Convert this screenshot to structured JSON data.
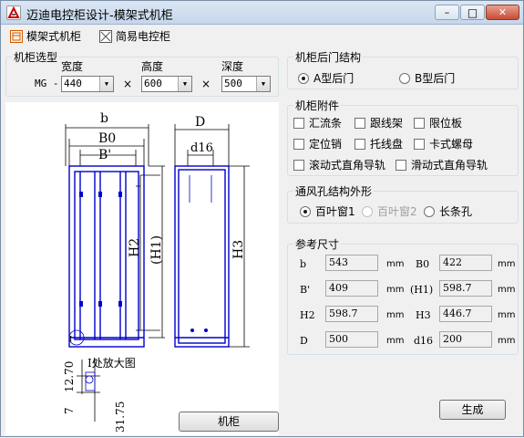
{
  "window": {
    "title": "迈迪电控柜设计-模架式机柜",
    "controls": {
      "minimize": "–",
      "maximize": "□",
      "close": "✕"
    }
  },
  "menu": {
    "items": [
      {
        "label": "模架式机柜",
        "icon": "cabinet-icon"
      },
      {
        "label": "简易电控柜",
        "icon": "simple-box-icon"
      }
    ]
  },
  "selection": {
    "legend": "机柜选型",
    "prefix": "MG -",
    "width_label": "宽度",
    "height_label": "高度",
    "depth_label": "深度",
    "width_value": "440",
    "height_value": "600",
    "depth_value": "500",
    "times": "×"
  },
  "drawing": {
    "labels": {
      "b": "b",
      "b0": "B0",
      "bprime": "B'",
      "h2": "H2",
      "h1": "(H1)",
      "h3": "H3",
      "d": "D",
      "d16": "d16",
      "detail_title": "I处放大图",
      "dim1": "12.70",
      "dim2": "7",
      "dim3": "31.75",
      "i": "I"
    },
    "accent": "#0000cc"
  },
  "rear_door": {
    "legend": "机柜后门结构",
    "options": [
      {
        "label": "A型后门",
        "checked": true
      },
      {
        "label": "B型后门",
        "checked": false
      }
    ]
  },
  "accessories": {
    "legend": "机柜附件",
    "items": [
      {
        "label": "汇流条",
        "checked": false
      },
      {
        "label": "跟线架",
        "checked": false
      },
      {
        "label": "限位板",
        "checked": false
      },
      {
        "label": "定位销",
        "checked": false
      },
      {
        "label": "托线盘",
        "checked": false
      },
      {
        "label": "卡式螺母",
        "checked": false
      },
      {
        "label": "滚动式直角导轨",
        "checked": false
      },
      {
        "label": "滑动式直角导轨",
        "checked": false
      }
    ]
  },
  "vent": {
    "legend": "通风孔结构外形",
    "options": [
      {
        "label": "百叶窗1",
        "checked": true,
        "disabled": false
      },
      {
        "label": "百叶窗2",
        "checked": false,
        "disabled": true
      },
      {
        "label": "长条孔",
        "checked": false,
        "disabled": false
      }
    ]
  },
  "reference": {
    "legend": "参考尺寸",
    "rows": [
      {
        "label": "b",
        "value": "543",
        "unit": "mm",
        "label2": "B0",
        "value2": "422",
        "unit2": "mm"
      },
      {
        "label": "B'",
        "value": "409",
        "unit": "mm",
        "label2": "(H1)",
        "value2": "598.7",
        "unit2": "mm"
      },
      {
        "label": "H2",
        "value": "598.7",
        "unit": "mm",
        "label2": "H3",
        "value2": "446.7",
        "unit2": "mm"
      },
      {
        "label": "D",
        "value": "500",
        "unit": "mm",
        "label2": "d16",
        "value2": "200",
        "unit2": "mm"
      }
    ]
  },
  "buttons": {
    "cabinet": "机柜",
    "generate": "生成"
  }
}
